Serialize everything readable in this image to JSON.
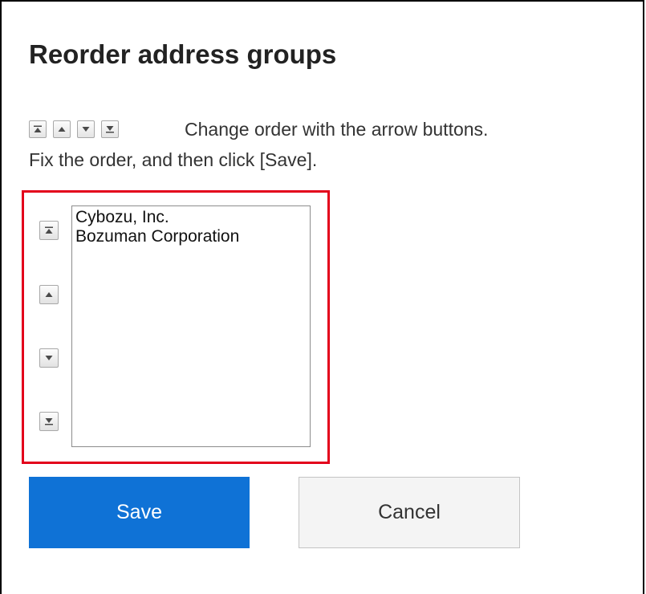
{
  "dialog": {
    "title": "Reorder address groups",
    "instruction_line1": "Change order with the arrow buttons.",
    "instruction_line2": "Fix the order, and then click [Save].",
    "hint_icons": [
      "move-top-icon",
      "move-up-icon",
      "move-down-icon",
      "move-bottom-icon"
    ]
  },
  "order_controls": {
    "icons": [
      "move-top-icon",
      "move-up-icon",
      "move-down-icon",
      "move-bottom-icon"
    ]
  },
  "group_list": {
    "items": [
      {
        "label": "Cybozu, Inc."
      },
      {
        "label": "Bozuman Corporation"
      }
    ]
  },
  "actions": {
    "save_label": "Save",
    "cancel_label": "Cancel"
  },
  "colors": {
    "primary": "#0f72d6",
    "highlight": "#e3001b"
  }
}
